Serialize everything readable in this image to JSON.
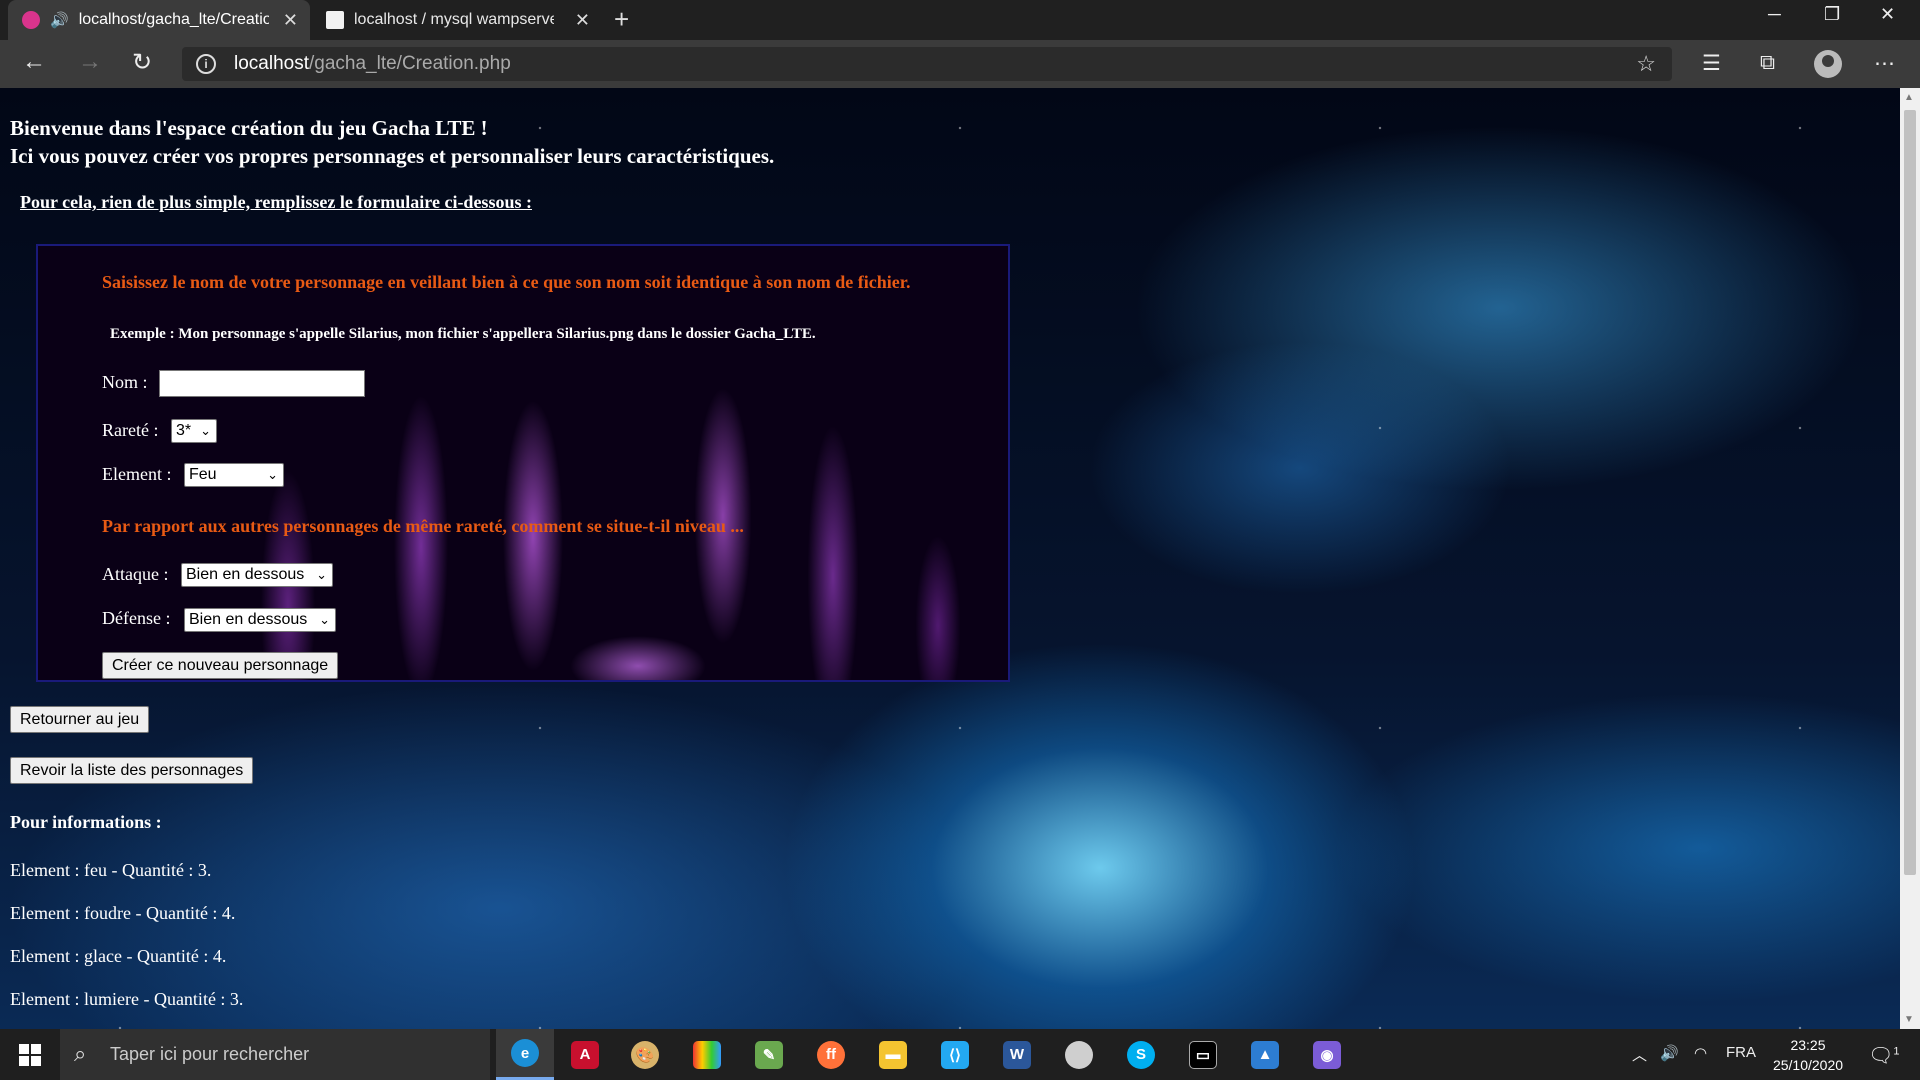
{
  "browser": {
    "tabs": [
      {
        "title": "localhost/gacha_lte/Creation.php",
        "active": true,
        "favicon_color": "#d9348c"
      },
      {
        "title": "localhost / mysql wampserver / g",
        "active": false,
        "favicon_color": "#f2f2f2"
      }
    ],
    "address": {
      "host": "localhost",
      "path": "/gacha_lte/Creation.php"
    }
  },
  "page": {
    "heading_line1": "Bienvenue dans l'espace création du jeu Gacha LTE !",
    "heading_line2": "Ici vous pouvez créer vos propres personnages et personnaliser leurs caractéristiques.",
    "intro": "Pour cela, rien de plus simple, remplissez le formulaire ci-dessous :",
    "form": {
      "warning": "Saisissez le nom de votre personnage en veillant bien à ce que son nom soit identique à son nom de fichier.",
      "example": "Exemple : Mon personnage s'appelle Silarius, mon fichier s'appellera Silarius.png dans le dossier Gacha_LTE.",
      "nom_label": "Nom :",
      "nom_value": "",
      "rarete_label": "Rareté :",
      "rarete_value": "3*",
      "element_label": "Element :",
      "element_value": "Feu",
      "level_question": "Par rapport aux autres personnages de même rareté, comment se situe-t-il niveau ...",
      "attaque_label": "Attaque :",
      "attaque_value": "Bien en dessous",
      "defense_label": "Défense :",
      "defense_value": "Bien en dessous",
      "submit_label": "Créer ce nouveau personnage"
    },
    "back_button": "Retourner au jeu",
    "list_button": "Revoir la liste des personnages",
    "info_title": "Pour informations :",
    "info_lines": [
      "Element : feu - Quantité : 3.",
      "Element : foudre - Quantité : 4.",
      "Element : glace - Quantité : 4.",
      "Element : lumiere - Quantité : 3."
    ]
  },
  "taskbar": {
    "search_placeholder": "Taper ici pour rechercher",
    "language": "FRA",
    "time": "23:25",
    "date": "25/10/2020",
    "notification_count": "1"
  },
  "colors": {
    "warning_text": "#e85a14",
    "chrome_dark": "#202020",
    "chrome_tab": "#3b3b3b"
  }
}
